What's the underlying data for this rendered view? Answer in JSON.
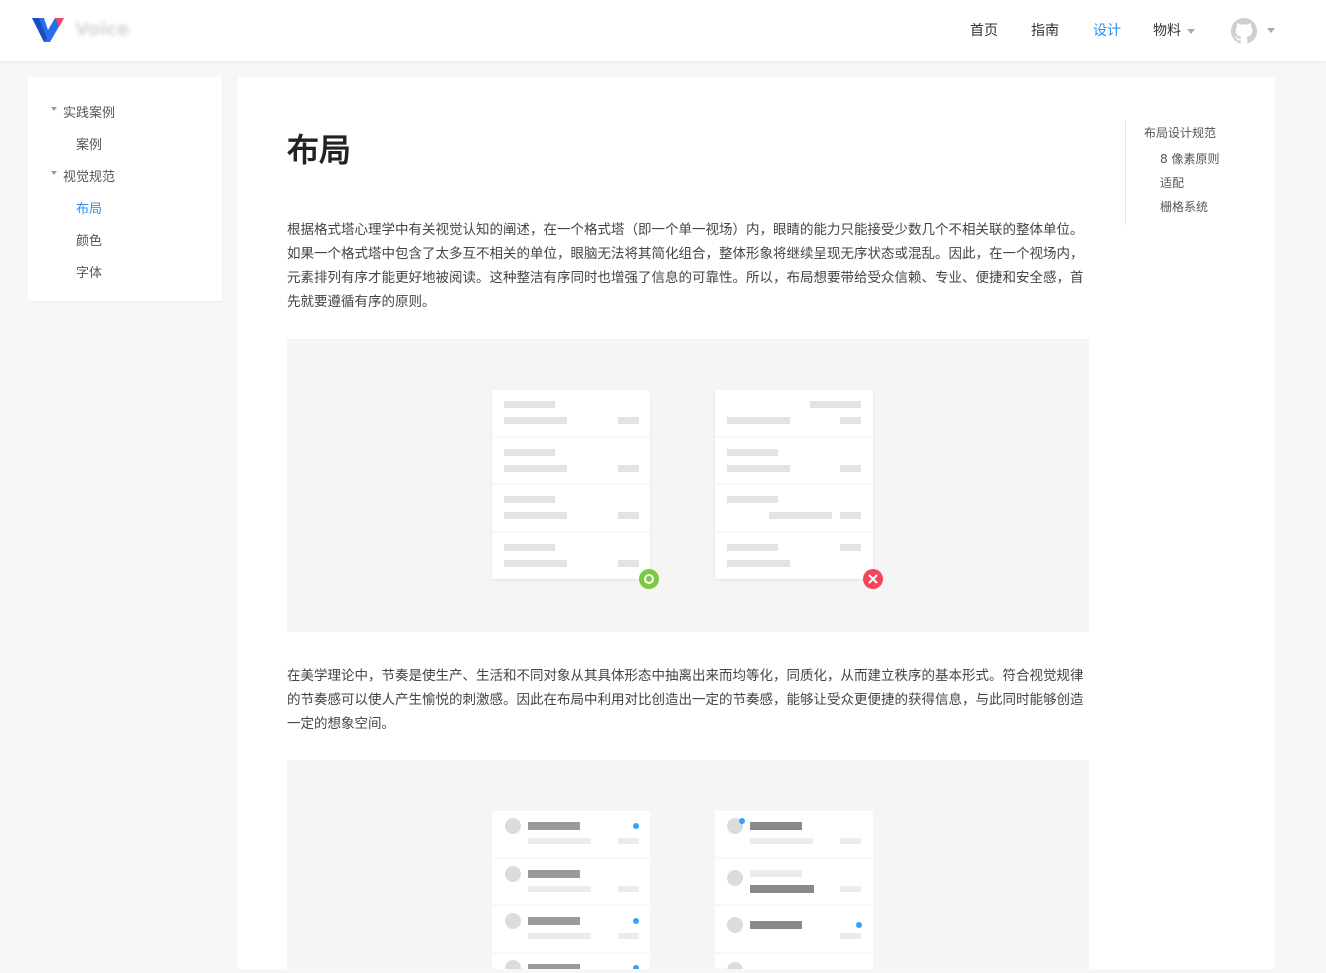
{
  "header": {
    "brand": "Voice",
    "nav": [
      "首页",
      "指南",
      "设计",
      "物料"
    ],
    "active_nav": "设计",
    "accent_color": "#2a8ff7"
  },
  "sidebar": {
    "groups": [
      {
        "label": "实践案例",
        "items": [
          "案例"
        ]
      },
      {
        "label": "视觉规范",
        "items": [
          "布局",
          "颜色",
          "字体"
        ]
      }
    ],
    "active_item": "布局"
  },
  "main": {
    "title": "布局",
    "paragraphs": [
      "根据格式塔心理学中有关视觉认知的阐述，在一个格式塔（即一个单一视场）内，眼睛的能力只能接受少数几个不相关联的整体单位。如果一个格式塔中包含了太多互不相关的单位，眼脑无法将其简化组合，整体形象将继续呈现无序状态或混乱。因此，在一个视场内，元素排列有序才能更好地被阅读。这种整洁有序同时也增强了信息的可靠性。所以，布局想要带给受众信赖、专业、便捷和安全感，首先就要遵循有序的原则。",
      "在美学理论中，节奏是使生产、生活和不同对象从其具体形态中抽离出来而均等化，同质化，从而建立秩序的基本形式。符合视觉规律的节奏感可以使人产生愉悦的刺激感。因此在布局中利用对比创造出一定的节奏感，能够让受众更便捷的获得信息，与此同时能够创造一定的想象空间。"
    ]
  },
  "toc": [
    "布局设计规范",
    "8 像素原则",
    "适配",
    "栅格系统"
  ],
  "colors": {
    "good": "#7ac943",
    "bad": "#f5455c",
    "dot": "#3aa0f7"
  }
}
